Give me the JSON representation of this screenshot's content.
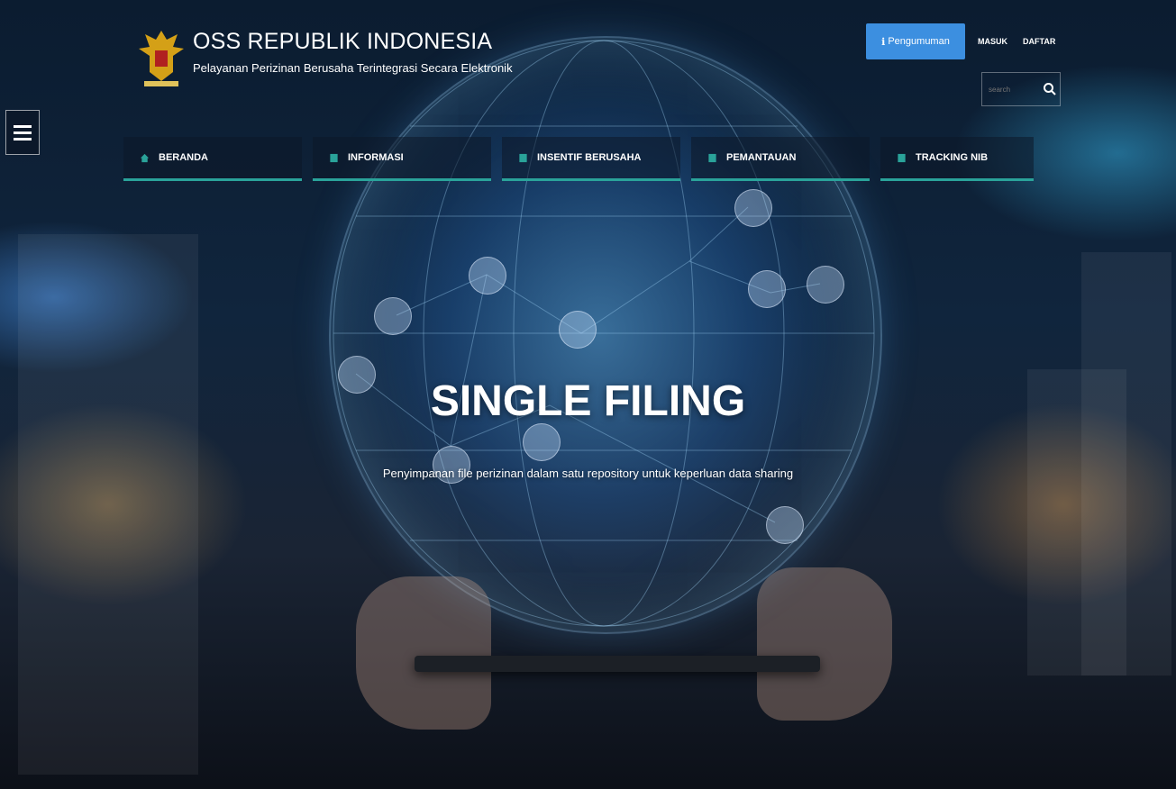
{
  "header": {
    "title": "OSS REPUBLIK INDONESIA",
    "subtitle": "Pelayanan Perizinan Berusaha Terintegrasi Secara Elektronik",
    "announcement_label": "Pengumuman",
    "login_label": "MASUK",
    "register_label": "DAFTAR",
    "search_placeholder": "search"
  },
  "nav": {
    "items": [
      {
        "label": "BERANDA",
        "icon": "home-icon"
      },
      {
        "label": "INFORMASI",
        "icon": "document-icon"
      },
      {
        "label": "INSENTIF BERUSAHA",
        "icon": "document-icon"
      },
      {
        "label": "PEMANTAUAN",
        "icon": "document-icon"
      },
      {
        "label": "TRACKING NIB",
        "icon": "document-icon"
      }
    ]
  },
  "hero": {
    "title": "SINGLE FILING",
    "subtitle": "Penyimpanan file perizinan dalam satu repository untuk keperluan data sharing"
  },
  "colors": {
    "accent": "#3c8fe0",
    "nav_underline": "#2aa39a",
    "icon_green": "#2aa39a"
  }
}
